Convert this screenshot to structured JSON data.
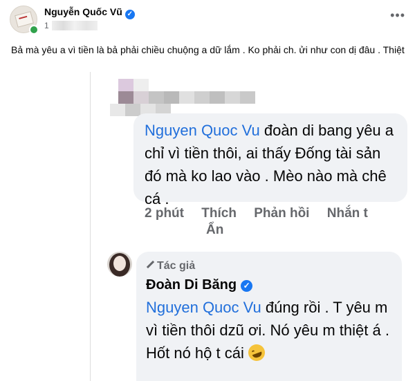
{
  "post": {
    "author": "Nguyễn Quốc Vũ",
    "time_visible": "1",
    "text": "Bả mà yêu a vì tiền là bả phải chiều chuộng a dữ lắm . Ko phải ch. ửi như con dị đâu . Thiệt"
  },
  "screenshot": {
    "comment1": {
      "tag": "Nguyen Quoc Vu",
      "text": " đoàn di bang yêu a chỉ vì tiền thôi, ai thấy Đống tài sản đó mà ko lao vào . Mèo nào mà chê cá ."
    },
    "actions": {
      "time": "2 phút",
      "like": "Thích",
      "reply": "Phản hồi",
      "message": "Nhắn t",
      "hide": "Ẩn"
    },
    "comment2": {
      "author_badge": "Tác giả",
      "author": "Đoàn Di Băng",
      "tag": "Nguyen Quoc Vu",
      "text": " đúng rồi . T yêu m vì tiền thôi dzũ ơi. Nó yêu m thiệt á . Hốt nó hộ t cái "
    }
  },
  "icons": {
    "verified": "verified-icon",
    "more": "more-icon",
    "pen": "pen-icon",
    "emoji": "rolling-laughing-emoji"
  },
  "colors": {
    "accent": "#1877f2",
    "mention": "#216fdb",
    "bubble": "#f0f2f5",
    "muted": "#65676b"
  }
}
